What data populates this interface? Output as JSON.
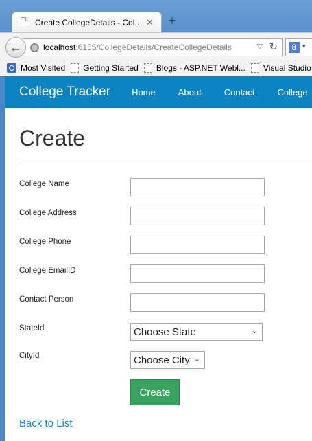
{
  "browser": {
    "tab_title": "Create CollegeDetails - Col...",
    "tab_close": "✕",
    "new_tab": "+",
    "url_host": "localhost",
    "url_path": ":6155/CollegeDetails/CreateCollegeDetails",
    "bookmarks": [
      "Most Visited",
      "Getting Started",
      "Blogs - ASP.NET Webl...",
      "Visual Studio"
    ],
    "search_engine_letter": "8"
  },
  "site": {
    "brand": "College Tracker",
    "nav": [
      "Home",
      "About",
      "Contact",
      "College"
    ],
    "brand_color": "#0c84c4"
  },
  "form": {
    "title": "Create",
    "fields": [
      {
        "label": "College Name",
        "value": ""
      },
      {
        "label": "College Address",
        "value": ""
      },
      {
        "label": "College Phone",
        "value": ""
      },
      {
        "label": "College EmailID",
        "value": ""
      },
      {
        "label": "Contact Person",
        "value": ""
      }
    ],
    "state": {
      "label": "StateId",
      "selected": "Choose State"
    },
    "city": {
      "label": "CityId",
      "selected": "Choose City"
    },
    "submit_label": "Create",
    "submit_color": "#3aa260",
    "back_link": "Back to List"
  }
}
